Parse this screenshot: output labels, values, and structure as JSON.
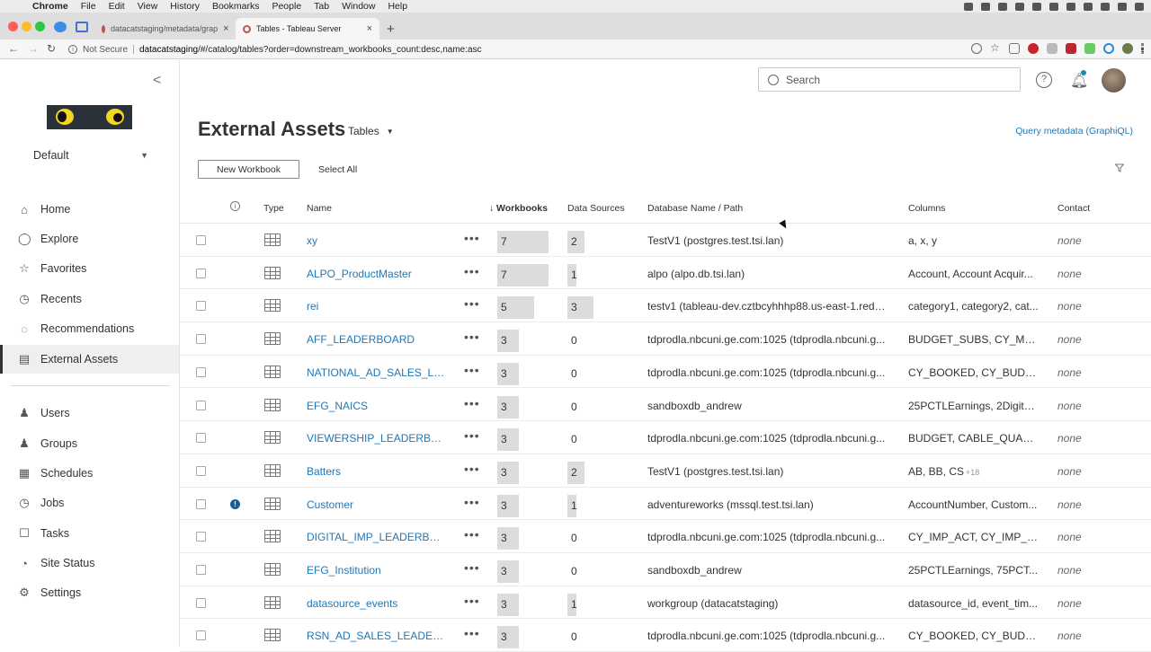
{
  "menubar": {
    "app": "Chrome",
    "items": [
      "File",
      "Edit",
      "View",
      "History",
      "Bookmarks",
      "People",
      "Tab",
      "Window",
      "Help"
    ]
  },
  "browser": {
    "tabs": [
      {
        "label": "datacatstaging/metadata/grap",
        "active": false
      },
      {
        "label": "Tables - Tableau Server",
        "active": true
      }
    ],
    "security_label": "Not Secure",
    "url_host": "datacatstaging",
    "url_path": "/#/catalog/tables?order=downstream_workbooks_count:desc,name:asc"
  },
  "sidebar": {
    "site": "Default",
    "items": [
      {
        "label": "Home",
        "icon": "home-icon",
        "glyph": "⌂"
      },
      {
        "label": "Explore",
        "icon": "explore-icon",
        "glyph": "◯"
      },
      {
        "label": "Favorites",
        "icon": "star-icon",
        "glyph": "☆"
      },
      {
        "label": "Recents",
        "icon": "clock-icon",
        "glyph": "◷"
      },
      {
        "label": "Recommendations",
        "icon": "lightbulb-icon",
        "glyph": "◌"
      },
      {
        "label": "External Assets",
        "icon": "database-icon",
        "glyph": "▤",
        "active": true
      },
      {
        "label": "Users",
        "icon": "users-icon",
        "glyph": "♟"
      },
      {
        "label": "Groups",
        "icon": "groups-icon",
        "glyph": "♟"
      },
      {
        "label": "Schedules",
        "icon": "calendar-icon",
        "glyph": "▦"
      },
      {
        "label": "Jobs",
        "icon": "jobs-icon",
        "glyph": "◷"
      },
      {
        "label": "Tasks",
        "icon": "tasks-icon",
        "glyph": "☐"
      },
      {
        "label": "Site Status",
        "icon": "status-icon",
        "glyph": "◔"
      },
      {
        "label": "Settings",
        "icon": "gear-icon",
        "glyph": "⚙"
      }
    ]
  },
  "header": {
    "search_placeholder": "Search"
  },
  "main": {
    "title": "External Assets",
    "view_select": "Tables",
    "graphiql_link": "Query metadata (GraphiQL)",
    "new_workbook": "New Workbook",
    "select_all": "Select All"
  },
  "table": {
    "columns": {
      "type": "Type",
      "name": "Name",
      "workbooks": "Workbooks",
      "sort_indicator": "↓",
      "data_sources": "Data Sources",
      "database": "Database Name / Path",
      "columns": "Columns",
      "contact": "Contact"
    },
    "rows": [
      {
        "name": "xy",
        "workbooks": 7,
        "data_sources": 2,
        "db": "TestV1 (postgres.test.tsi.lan)",
        "cols": "a, x, y",
        "cols_more": "",
        "contact": "none",
        "warning": false
      },
      {
        "name": "ALPO_ProductMaster",
        "workbooks": 7,
        "data_sources": 1,
        "db": "alpo (alpo.db.tsi.lan)",
        "cols": "Account, Account Acquir...",
        "cols_more": "",
        "contact": "none",
        "warning": false
      },
      {
        "name": "rei",
        "workbooks": 5,
        "data_sources": 3,
        "db": "testv1 (tableau-dev.cztbcyhhhp88.us-east-1.reds...",
        "cols": "category1, category2, cat...",
        "cols_more": "",
        "contact": "none",
        "warning": false
      },
      {
        "name": "AFF_LEADERBOARD",
        "workbooks": 3,
        "data_sources": 0,
        "db": "tdprodla.nbcuni.ge.com:1025 (tdprodla.nbcuni.g...",
        "cols": "BUDGET_SUBS, CY_MO...",
        "cols_more": "",
        "contact": "none",
        "warning": false
      },
      {
        "name": "NATIONAL_AD_SALES_LE...",
        "workbooks": 3,
        "data_sources": 0,
        "db": "tdprodla.nbcuni.ge.com:1025 (tdprodla.nbcuni.g...",
        "cols": "CY_BOOKED, CY_BUDGE...",
        "cols_more": "",
        "contact": "none",
        "warning": false
      },
      {
        "name": "EFG_NAICS",
        "workbooks": 3,
        "data_sources": 0,
        "db": "sandboxdb_andrew",
        "cols": "25PCTLEarnings, 2DigitN...",
        "cols_more": "",
        "contact": "none",
        "warning": false
      },
      {
        "name": "VIEWERSHIP_LEADERBO...",
        "workbooks": 3,
        "data_sources": 0,
        "db": "tdprodla.nbcuni.ge.com:1025 (tdprodla.nbcuni.g...",
        "cols": "BUDGET, CABLE_QUART...",
        "cols_more": "",
        "contact": "none",
        "warning": false
      },
      {
        "name": "Batters",
        "workbooks": 3,
        "data_sources": 2,
        "db": "TestV1 (postgres.test.tsi.lan)",
        "cols": "AB, BB, CS",
        "cols_more": "+18",
        "contact": "none",
        "warning": false
      },
      {
        "name": "Customer",
        "workbooks": 3,
        "data_sources": 1,
        "db": "adventureworks (mssql.test.tsi.lan)",
        "cols": "AccountNumber, Custom...",
        "cols_more": "",
        "contact": "none",
        "warning": true
      },
      {
        "name": "DIGITAL_IMP_LEADERBO...",
        "workbooks": 3,
        "data_sources": 0,
        "db": "tdprodla.nbcuni.ge.com:1025 (tdprodla.nbcuni.g...",
        "cols": "CY_IMP_ACT, CY_IMP_ES...",
        "cols_more": "",
        "contact": "none",
        "warning": false
      },
      {
        "name": "EFG_Institution",
        "workbooks": 3,
        "data_sources": 0,
        "db": "sandboxdb_andrew",
        "cols": "25PCTLEarnings, 75PCT...",
        "cols_more": "",
        "contact": "none",
        "warning": false
      },
      {
        "name": "datasource_events",
        "workbooks": 3,
        "data_sources": 1,
        "db": "workgroup (datacatstaging)",
        "cols": "datasource_id, event_tim...",
        "cols_more": "",
        "contact": "none",
        "warning": false
      },
      {
        "name": "RSN_AD_SALES_LEADER...",
        "workbooks": 3,
        "data_sources": 0,
        "db": "tdprodla.nbcuni.ge.com:1025 (tdprodla.nbcuni.g...",
        "cols": "CY_BOOKED, CY_BUDGE...",
        "cols_more": "",
        "contact": "none",
        "warning": false
      }
    ]
  }
}
